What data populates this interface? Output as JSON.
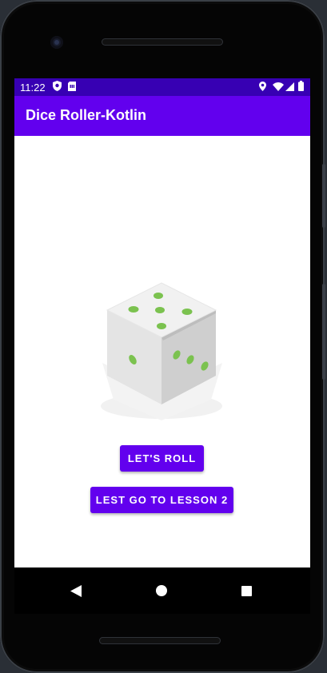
{
  "statusbar": {
    "time": "11:22"
  },
  "appbar": {
    "title": "Dice Roller-Kotlin"
  },
  "buttons": {
    "roll_label": "LET'S ROLL",
    "lesson_label": "LEST GO TO LESSON 2"
  },
  "dice": {
    "value": 5,
    "pip_color": "#7bc24f"
  },
  "colors": {
    "primary": "#6200ee",
    "primary_dark": "#3700b3"
  },
  "icons": {
    "status": [
      "shield-icon",
      "sim-card-icon",
      "location-icon",
      "wifi-icon",
      "signal-icon",
      "battery-icon"
    ],
    "nav": [
      "back-icon",
      "home-icon",
      "recents-icon"
    ]
  }
}
